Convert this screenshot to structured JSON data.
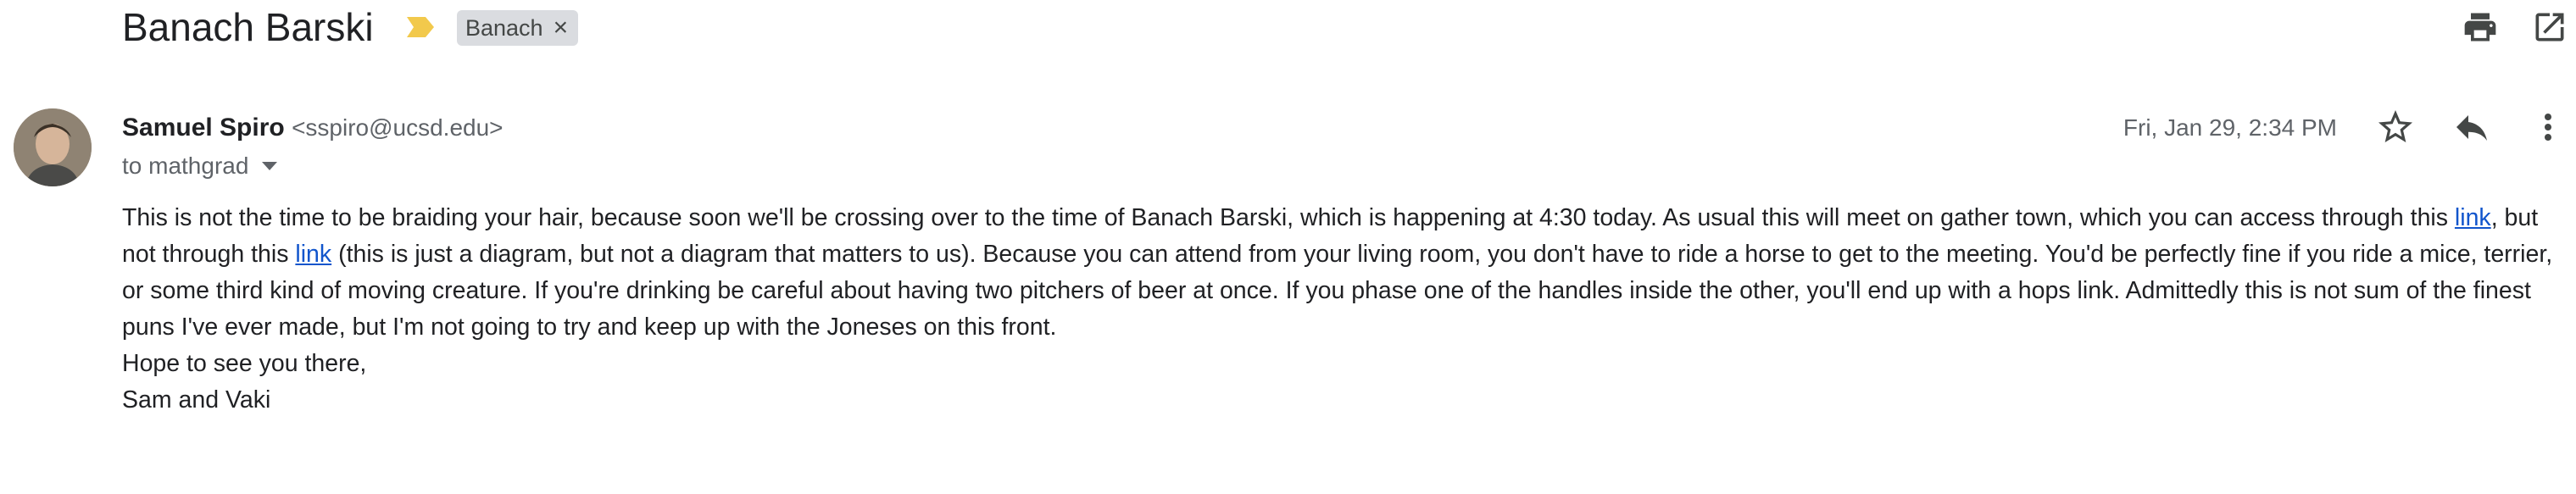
{
  "email": {
    "subject": "Banach Barski",
    "label": "Banach",
    "label_remove": "×",
    "sender": {
      "name": "Samuel Spiro",
      "email": "<sspiro@ucsd.edu>"
    },
    "recipient": "to mathgrad",
    "timestamp": "Fri, Jan 29, 2:34 PM",
    "body": {
      "p1_a": "This is not the time to be braiding your hair, because soon we'll be crossing over to the time of Banach Barski, which is happening at 4:30 today.  As usual this will meet on gather town, which you can access through this ",
      "link1": "link",
      "p1_b": ", but not through this ",
      "link2": "link",
      "p1_c": " (this is just a diagram, but not a diagram that matters to us).  Because you can attend from your living room, you don't have to ride a horse to get to the meeting.  You'd be perfectly fine if you ride a mice, terrier, or some third kind of moving creature.  If you're drinking be careful about having two pitchers of beer at once.  If you phase one of the handles inside the other, you'll end up with a hops link.  Admittedly this is not sum of the finest puns I've ever made, but I'm not going to try and keep up with the Joneses on this front.",
      "closing_1": "Hope to see you there,",
      "closing_2": "Sam and Vaki"
    }
  },
  "icons": {
    "importance": "importance-marker-icon",
    "print": "print-icon",
    "open_new_window": "open-in-new-window-icon",
    "star": "star-icon",
    "reply": "reply-icon",
    "more": "more-vert-icon"
  },
  "colors": {
    "importance_marker": "#f2c94c",
    "chip_bg": "#dadce0",
    "link": "#1155cc",
    "secondary_text": "#5f6368"
  }
}
